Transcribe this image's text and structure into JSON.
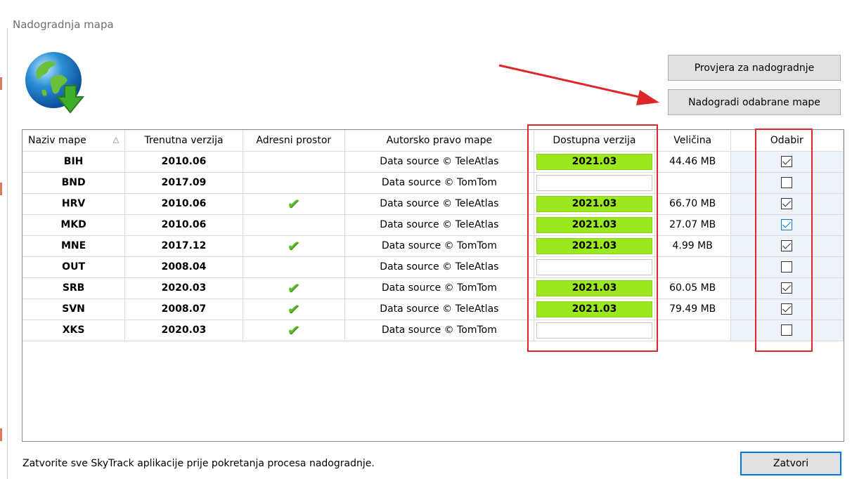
{
  "window": {
    "title": "Nadogradnja mapa"
  },
  "toolbar": {
    "check_updates_label": "Provjera za nadogradnje",
    "upgrade_selected_label": "Nadogradi odabrane mape"
  },
  "table": {
    "columns": [
      "Naziv mape",
      "Trenutna verzija",
      "Adresni prostor",
      "Autorsko pravo mape",
      "Dostupna verzija",
      "Veličina",
      "Odabir"
    ],
    "sort_indicator": "△",
    "rows": [
      {
        "name": "BIH",
        "current": "2010.06",
        "address": false,
        "copyright": "Data source © TeleAtlas",
        "available": "2021.03",
        "size": "44.46 MB",
        "selected": true,
        "focused": false
      },
      {
        "name": "BND",
        "current": "2017.09",
        "address": false,
        "copyright": "Data source © TomTom",
        "available": "",
        "size": "",
        "selected": false,
        "focused": false
      },
      {
        "name": "HRV",
        "current": "2010.06",
        "address": true,
        "copyright": "Data source © TeleAtlas",
        "available": "2021.03",
        "size": "66.70 MB",
        "selected": true,
        "focused": false
      },
      {
        "name": "MKD",
        "current": "2010.06",
        "address": false,
        "copyright": "Data source © TeleAtlas",
        "available": "2021.03",
        "size": "27.07 MB",
        "selected": true,
        "focused": true
      },
      {
        "name": "MNE",
        "current": "2017.12",
        "address": true,
        "copyright": "Data source © TomTom",
        "available": "2021.03",
        "size": "4.99 MB",
        "selected": true,
        "focused": false
      },
      {
        "name": "OUT",
        "current": "2008.04",
        "address": false,
        "copyright": "Data source © TeleAtlas",
        "available": "",
        "size": "",
        "selected": false,
        "focused": false
      },
      {
        "name": "SRB",
        "current": "2020.03",
        "address": true,
        "copyright": "Data source © TomTom",
        "available": "2021.03",
        "size": "60.05 MB",
        "selected": true,
        "focused": false
      },
      {
        "name": "SVN",
        "current": "2008.07",
        "address": true,
        "copyright": "Data source © TeleAtlas",
        "available": "2021.03",
        "size": "79.49 MB",
        "selected": true,
        "focused": false
      },
      {
        "name": "XKS",
        "current": "2020.03",
        "address": true,
        "copyright": "Data source © TomTom",
        "available": "",
        "size": "",
        "selected": false,
        "focused": false
      }
    ]
  },
  "footer": {
    "status_text": "Zatvorite sve SkyTrack aplikacije prije pokretanja procesa nadogradnje.",
    "close_label": "Zatvori"
  },
  "colors": {
    "available_highlight": "#9be81e",
    "annotation_red": "#e0262a",
    "select_column_bg": "#eef3fa",
    "accent": "#0078d7"
  },
  "icons": {
    "globe": "globe-download-icon",
    "address_present": "green-check-icon"
  }
}
